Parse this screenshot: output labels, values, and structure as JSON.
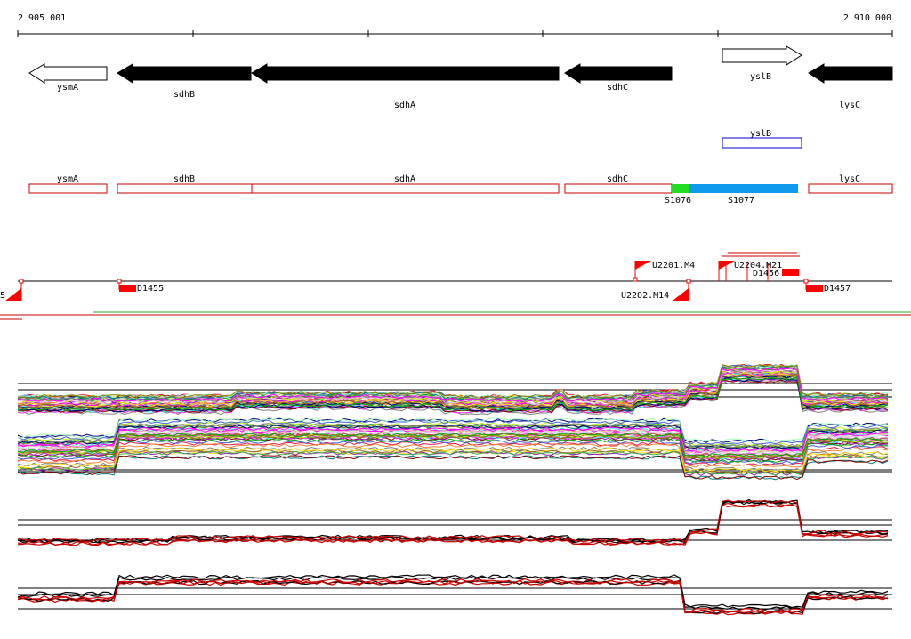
{
  "ruler": {
    "start_label": "2 905 001",
    "end_label": "2 910 000"
  },
  "genes": [
    {
      "name": "ysmA",
      "strand": "+",
      "filled": false
    },
    {
      "name": "sdhB",
      "strand": "-",
      "filled": true
    },
    {
      "name": "sdhA",
      "strand": "-",
      "filled": true
    },
    {
      "name": "sdhC",
      "strand": "-",
      "filled": true
    },
    {
      "name": "yslB",
      "strand": "+",
      "filled": false
    },
    {
      "name": "lysC",
      "strand": "-",
      "filled": true
    }
  ],
  "highlight_box": {
    "label": "yslB",
    "color": "#0000cc"
  },
  "gene_boxes": {
    "color": "#cc0000",
    "labels": [
      "ysmA",
      "sdhB",
      "sdhA",
      "sdhC",
      "lysC"
    ]
  },
  "segments": [
    {
      "label": "S1076",
      "color": "#22dd22"
    },
    {
      "label": "S1077",
      "color": "#1199ee"
    }
  ],
  "features": {
    "color": "#ff0000",
    "left_edge_label": "5",
    "labels": [
      "D1455",
      "U2201.M4",
      "U2202.M14",
      "U2204.M21",
      "D1456",
      "D1457"
    ]
  },
  "tracks": {
    "colors": [
      "#e6194b",
      "#3cb44b",
      "#ffe119",
      "#4363d8",
      "#f58231",
      "#911eb4",
      "#46f0f0",
      "#f032e6",
      "#bcf60c",
      "#fabebe",
      "#008080",
      "#e6beff",
      "#9a6324",
      "#800000",
      "#aaffc3",
      "#808000",
      "#000075",
      "#808080",
      "#ff00ff",
      "#00aa00"
    ],
    "summary_colors": [
      "#000000",
      "#cc0000"
    ]
  }
}
